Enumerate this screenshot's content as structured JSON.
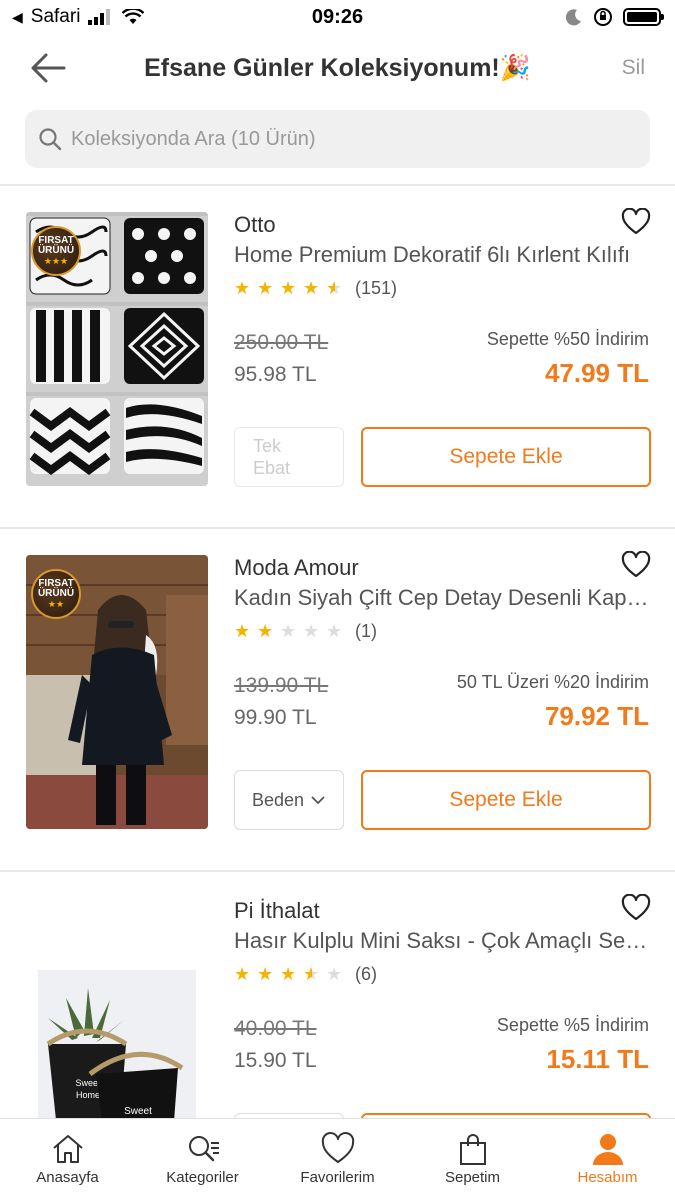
{
  "status_bar": {
    "carrier": "Safari",
    "time": "09:26"
  },
  "header": {
    "title": "Efsane Günler Koleksiyonum!🎉",
    "delete_label": "Sil"
  },
  "search": {
    "placeholder": "Koleksiyonda Ara (10 Ürün)"
  },
  "badge": {
    "line1": "FIRSAT",
    "line2": "ÜRÜNÜ"
  },
  "products": [
    {
      "brand": "Otto",
      "name": "Home Premium Dekoratif 6lı Kırlent Kılıfı",
      "rating": 4.5,
      "rating_count": "(151)",
      "old_price": "250.00 TL",
      "price": "95.98 TL",
      "promo": "Sepette %50 İndirim",
      "promo_price": "47.99 TL",
      "variant_label": "Tek Ebat",
      "cart_label": "Sepete Ekle"
    },
    {
      "brand": "Moda Amour",
      "name": "Kadın Siyah Çift Cep Detay Desenli Kapüşonlu Yağmurluk",
      "rating": 2,
      "rating_count": "(1)",
      "old_price": "139.90 TL",
      "price": "99.90 TL",
      "promo": "50 TL Üzeri %20 İndirim",
      "promo_price": "79.92 TL",
      "variant_label": "Beden",
      "cart_label": "Sepete Ekle"
    },
    {
      "brand": "Pi İthalat",
      "name": "Hasır Kulplu Mini Saksı - Çok Amaçlı Sepet",
      "rating": 3.5,
      "rating_count": "(6)",
      "old_price": "40.00 TL",
      "price": "15.90 TL",
      "promo": "Sepette %5 İndirim",
      "promo_price": "15.11 TL",
      "pot_text": "Sweet Home"
    }
  ],
  "bottom_nav": {
    "items": [
      {
        "label": "Anasayfa",
        "icon": "home-icon"
      },
      {
        "label": "Kategoriler",
        "icon": "categories-icon"
      },
      {
        "label": "Favorilerim",
        "icon": "heart-icon"
      },
      {
        "label": "Sepetim",
        "icon": "bag-icon"
      },
      {
        "label": "Hesabım",
        "icon": "user-icon",
        "active": true
      }
    ]
  },
  "colors": {
    "accent": "#f27a1a",
    "star": "#f5b400"
  }
}
